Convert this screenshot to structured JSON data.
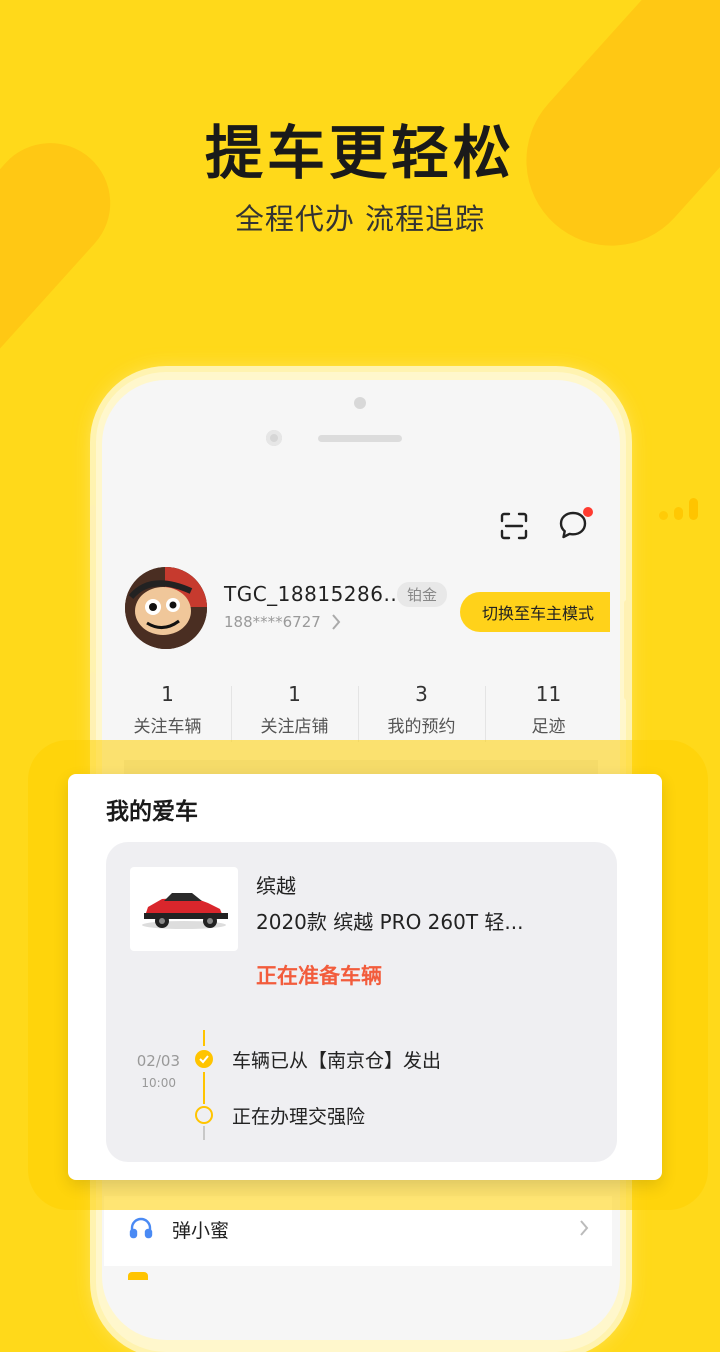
{
  "hero": {
    "title": "提车更轻松",
    "subtitle": "全程代办 流程追踪"
  },
  "profile": {
    "username": "TGC_18815286...",
    "badge": "铂金",
    "phone": "188****6727",
    "switch_button": "切换至车主模式"
  },
  "stats": [
    {
      "value": "1",
      "label": "关注车辆"
    },
    {
      "value": "1",
      "label": "关注店铺"
    },
    {
      "value": "3",
      "label": "我的预约"
    },
    {
      "value": "11",
      "label": "足迹"
    }
  ],
  "my_car": {
    "title": "我的爱车",
    "car_name": "缤越",
    "car_model": "2020款 缤越 PRO 260T 轻...",
    "status": "正在准备车辆",
    "timeline": [
      {
        "date": "02/03",
        "time": "10:00",
        "text": "车辆已从【南京仓】发出",
        "done": true
      },
      {
        "date": "",
        "time": "",
        "text": "正在办理交强险",
        "done": false
      }
    ]
  },
  "menu": {
    "assistant_label": "弹小蜜"
  },
  "colors": {
    "brand_yellow": "#ffd91a",
    "status_red": "#f25c3c"
  },
  "icons": {
    "scan": "scan-icon",
    "message": "message-icon",
    "headset": "headset-icon"
  }
}
